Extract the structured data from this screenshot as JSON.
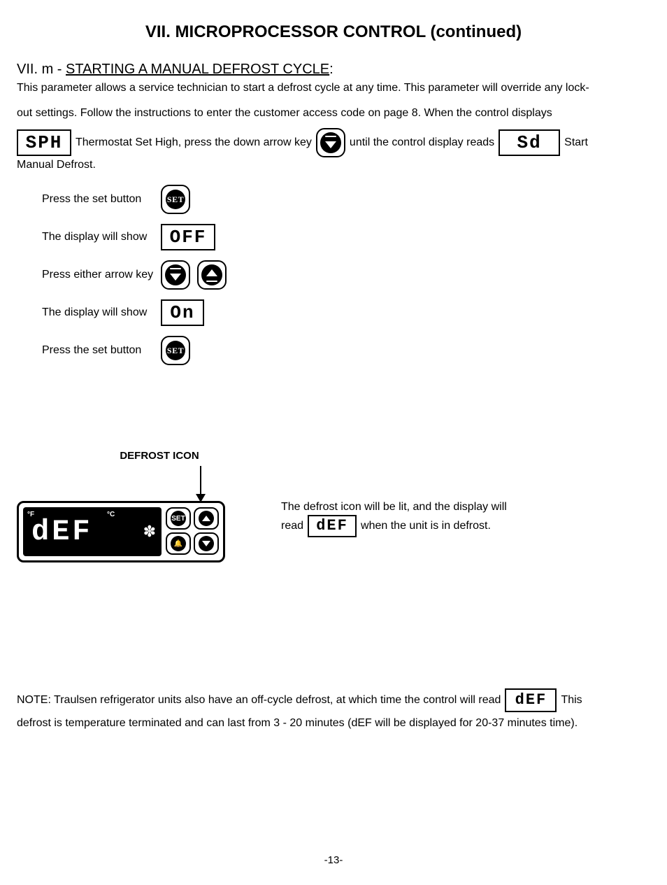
{
  "page_title": "VII. MICROPROCESSOR CONTROL (continued)",
  "section": {
    "prefix": "VII. m - ",
    "heading": "STARTING A MANUAL DEFROST CYCLE",
    "colon": ":"
  },
  "intro": "This parameter allows a service technician to start a defrost cycle at any time. This parameter will override any lock-",
  "line2_pre": "out settings.  Follow the instructions to enter the customer access code on page 8. When the control displays",
  "line3": {
    "seg_sph": "SPH",
    "text_a": "Thermostat Set High, press the down arrow key",
    "text_b": "until the control display reads",
    "seg_sd": "Sd",
    "text_c": "Start"
  },
  "line4": "Manual Defrost.",
  "steps": [
    {
      "label": "Press the set button",
      "type": "set"
    },
    {
      "label": "The display will show",
      "type": "seg",
      "value": "OFF"
    },
    {
      "label": "Press either arrow key",
      "type": "arrows"
    },
    {
      "label": "The display will show",
      "type": "seg",
      "value": "On"
    },
    {
      "label": "Press the set button",
      "type": "set"
    }
  ],
  "set_label": "SET",
  "defrost": {
    "caption": "DEFROST ICON",
    "panel_text": "dEF",
    "panel_units_f": "°F",
    "panel_units_c": "°C",
    "panel_set": "SET",
    "side_line1": "The defrost icon will be lit, and the display will",
    "side_read": "read",
    "side_seg": "dEF",
    "side_line2_rest": "when the unit is in defrost."
  },
  "note": {
    "line1_pre": "NOTE: Traulsen refrigerator units also have an off-cycle defrost, at which time the control will read",
    "seg": "dEF",
    "line1_post": "This",
    "line2": "defrost is temperature terminated and can last from 3 - 20 minutes (dEF will be displayed for 20-37 minutes time)."
  },
  "page_number": "-13-"
}
